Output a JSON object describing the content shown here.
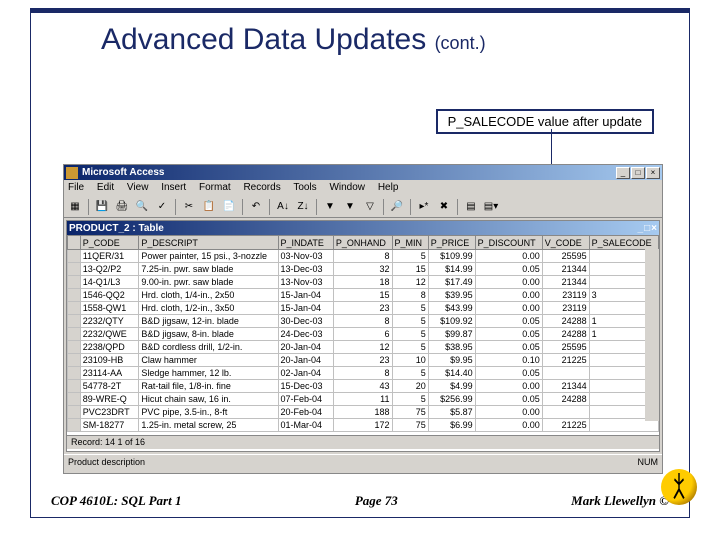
{
  "slide": {
    "title_main": "Advanced Data Updates",
    "title_cont": "(cont.)",
    "callout": "P_SALECODE value after update"
  },
  "app": {
    "title": "Microsoft Access",
    "menu": [
      "File",
      "Edit",
      "View",
      "Insert",
      "Format",
      "Records",
      "Tools",
      "Window",
      "Help"
    ],
    "inner_title": "PRODUCT_2 : Table",
    "status_left": "Product description",
    "status_right": "NUM",
    "nav": "Record: 14  1  of 16"
  },
  "grid": {
    "columns": [
      "",
      "P_CODE",
      "P_DESCRIPT",
      "P_INDATE",
      "P_ONHAND",
      "P_MIN",
      "P_PRICE",
      "P_DISCOUNT",
      "V_CODE",
      "P_SALECODE"
    ],
    "widths": [
      12,
      55,
      130,
      52,
      50,
      34,
      44,
      55,
      44,
      62
    ],
    "rows": [
      [
        "",
        "11QER/31",
        "Power painter, 15 psi., 3-nozzle",
        "03-Nov-03",
        "8",
        "5",
        "$109.99",
        "0.00",
        "25595",
        ""
      ],
      [
        "",
        "13-Q2/P2",
        "7.25-in. pwr. saw blade",
        "13-Dec-03",
        "32",
        "15",
        "$14.99",
        "0.05",
        "21344",
        ""
      ],
      [
        "",
        "14-Q1/L3",
        "9.00-in. pwr. saw blade",
        "13-Nov-03",
        "18",
        "12",
        "$17.49",
        "0.00",
        "21344",
        ""
      ],
      [
        "",
        "1546-QQ2",
        "Hrd. cloth, 1/4-in., 2x50",
        "15-Jan-04",
        "15",
        "8",
        "$39.95",
        "0.00",
        "23119",
        "3"
      ],
      [
        "",
        "1558-QW1",
        "Hrd. cloth, 1/2-in., 3x50",
        "15-Jan-04",
        "23",
        "5",
        "$43.99",
        "0.00",
        "23119",
        ""
      ],
      [
        "",
        "2232/QTY",
        "B&D jigsaw, 12-in. blade",
        "30-Dec-03",
        "8",
        "5",
        "$109.92",
        "0.05",
        "24288",
        "1"
      ],
      [
        "",
        "2232/QWE",
        "B&D jigsaw, 8-in. blade",
        "24-Dec-03",
        "6",
        "5",
        "$99.87",
        "0.05",
        "24288",
        "1"
      ],
      [
        "",
        "2238/QPD",
        "B&D cordless drill, 1/2-in.",
        "20-Jan-04",
        "12",
        "5",
        "$38.95",
        "0.05",
        "25595",
        ""
      ],
      [
        "",
        "23109-HB",
        "Claw hammer",
        "20-Jan-04",
        "23",
        "10",
        "$9.95",
        "0.10",
        "21225",
        ""
      ],
      [
        "",
        "23114-AA",
        "Sledge hammer, 12 lb.",
        "02-Jan-04",
        "8",
        "5",
        "$14.40",
        "0.05",
        "",
        ""
      ],
      [
        "",
        "54778-2T",
        "Rat-tail file, 1/8-in. fine",
        "15-Dec-03",
        "43",
        "20",
        "$4.99",
        "0.00",
        "21344",
        ""
      ],
      [
        "",
        "89-WRE-Q",
        "Hicut chain saw, 16 in.",
        "07-Feb-04",
        "11",
        "5",
        "$256.99",
        "0.05",
        "24288",
        ""
      ],
      [
        "",
        "PVC23DRT",
        "PVC pipe, 3.5-in., 8-ft",
        "20-Feb-04",
        "188",
        "75",
        "$5.87",
        "0.00",
        "",
        ""
      ],
      [
        "",
        "SM-18277",
        "1.25-in. metal screw, 25",
        "01-Mar-04",
        "172",
        "75",
        "$6.99",
        "0.00",
        "21225",
        ""
      ]
    ]
  },
  "footer": {
    "left": "COP 4610L: SQL Part 1",
    "center": "Page 73",
    "right": "Mark Llewellyn ©"
  },
  "chart_data": {
    "type": "table",
    "title": "PRODUCT_2 : Table",
    "columns": [
      "P_CODE",
      "P_DESCRIPT",
      "P_INDATE",
      "P_ONHAND",
      "P_MIN",
      "P_PRICE",
      "P_DISCOUNT",
      "V_CODE",
      "P_SALECODE"
    ],
    "rows": [
      [
        "11QER/31",
        "Power painter, 15 psi., 3-nozzle",
        "03-Nov-03",
        8,
        5,
        109.99,
        0.0,
        "25595",
        null
      ],
      [
        "13-Q2/P2",
        "7.25-in. pwr. saw blade",
        "13-Dec-03",
        32,
        15,
        14.99,
        0.05,
        "21344",
        null
      ],
      [
        "14-Q1/L3",
        "9.00-in. pwr. saw blade",
        "13-Nov-03",
        18,
        12,
        17.49,
        0.0,
        "21344",
        null
      ],
      [
        "1546-QQ2",
        "Hrd. cloth, 1/4-in., 2x50",
        "15-Jan-04",
        15,
        8,
        39.95,
        0.0,
        "23119",
        "3"
      ],
      [
        "1558-QW1",
        "Hrd. cloth, 1/2-in., 3x50",
        "15-Jan-04",
        23,
        5,
        43.99,
        0.0,
        "23119",
        null
      ],
      [
        "2232/QTY",
        "B&D jigsaw, 12-in. blade",
        "30-Dec-03",
        8,
        5,
        109.92,
        0.05,
        "24288",
        "1"
      ],
      [
        "2232/QWE",
        "B&D jigsaw, 8-in. blade",
        "24-Dec-03",
        6,
        5,
        99.87,
        0.05,
        "24288",
        "1"
      ],
      [
        "2238/QPD",
        "B&D cordless drill, 1/2-in.",
        "20-Jan-04",
        12,
        5,
        38.95,
        0.05,
        "25595",
        null
      ],
      [
        "23109-HB",
        "Claw hammer",
        "20-Jan-04",
        23,
        10,
        9.95,
        0.1,
        "21225",
        null
      ],
      [
        "23114-AA",
        "Sledge hammer, 12 lb.",
        "02-Jan-04",
        8,
        5,
        14.4,
        0.05,
        null,
        null
      ],
      [
        "54778-2T",
        "Rat-tail file, 1/8-in. fine",
        "15-Dec-03",
        43,
        20,
        4.99,
        0.0,
        "21344",
        null
      ],
      [
        "89-WRE-Q",
        "Hicut chain saw, 16 in.",
        "07-Feb-04",
        11,
        5,
        256.99,
        0.05,
        "24288",
        null
      ],
      [
        "PVC23DRT",
        "PVC pipe, 3.5-in., 8-ft",
        "20-Feb-04",
        188,
        75,
        5.87,
        0.0,
        null,
        null
      ],
      [
        "SM-18277",
        "1.25-in. metal screw, 25",
        "01-Mar-04",
        172,
        75,
        6.99,
        0.0,
        "21225",
        null
      ]
    ]
  }
}
